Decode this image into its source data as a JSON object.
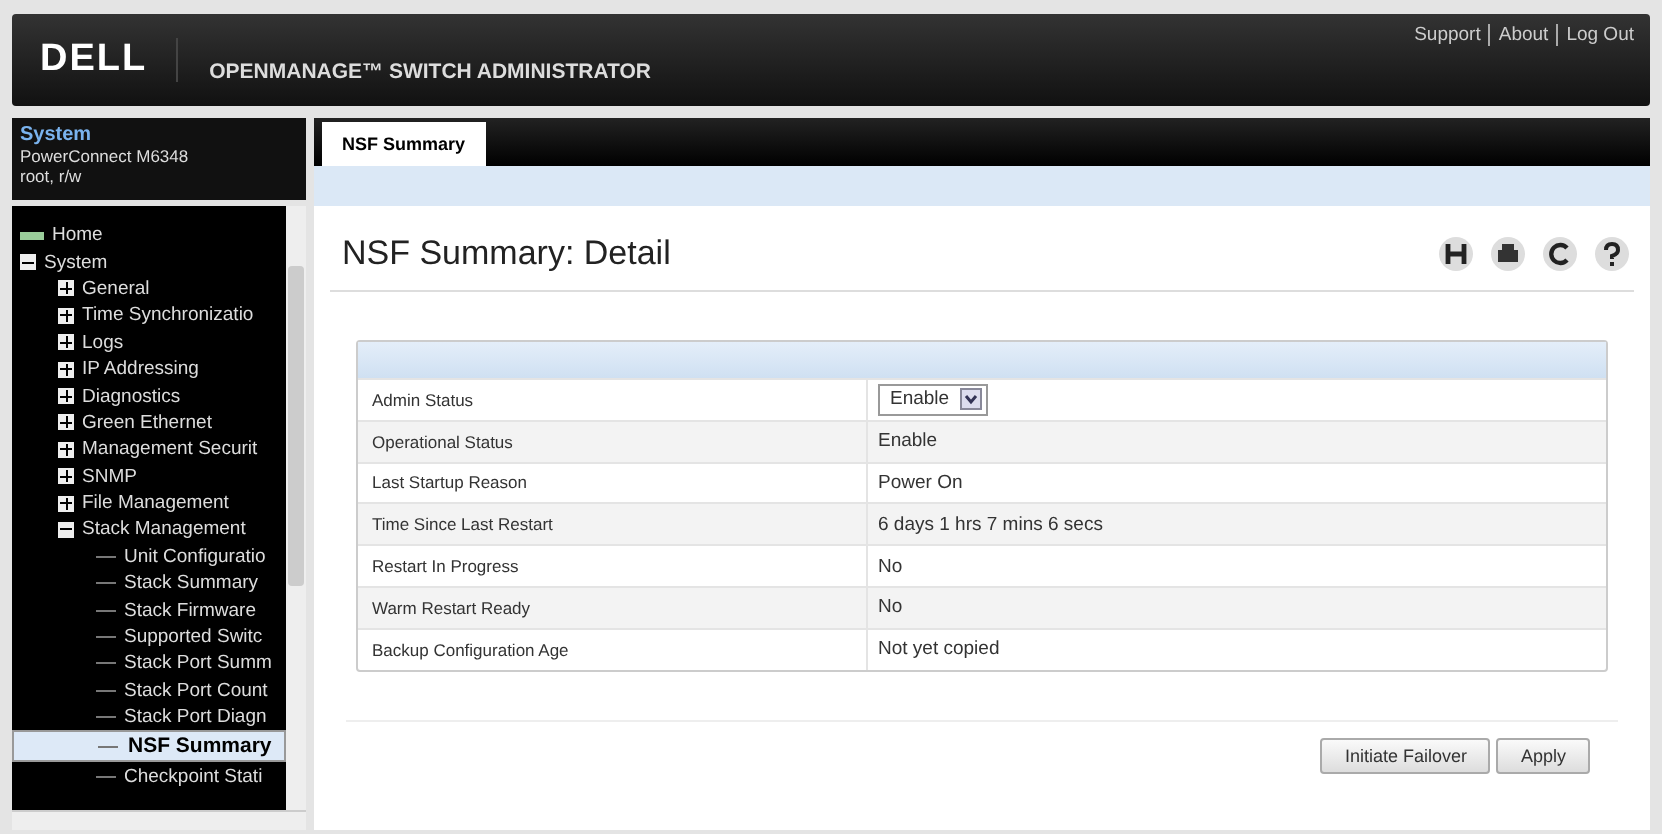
{
  "header": {
    "brand": "DELL",
    "product": "OPENMANAGE™ SWITCH ADMINISTRATOR",
    "links": [
      "Support",
      "About",
      "Log Out"
    ]
  },
  "system": {
    "title": "System",
    "model": "PowerConnect M6348",
    "user": "root, r/w"
  },
  "tree": [
    {
      "label": "Home",
      "kind": "home",
      "selected": false
    },
    {
      "label": "System",
      "kind": "folder",
      "expanded": true,
      "selected": false,
      "children": [
        {
          "label": "General",
          "kind": "folder",
          "expanded": false,
          "selected": false
        },
        {
          "label": "Time Synchronizatio",
          "kind": "folder",
          "expanded": false,
          "selected": false
        },
        {
          "label": "Logs",
          "kind": "folder",
          "expanded": false,
          "selected": false
        },
        {
          "label": "IP Addressing",
          "kind": "folder",
          "expanded": false,
          "selected": false
        },
        {
          "label": "Diagnostics",
          "kind": "folder",
          "expanded": false,
          "selected": false
        },
        {
          "label": "Green Ethernet",
          "kind": "folder",
          "expanded": false,
          "selected": false
        },
        {
          "label": "Management Securit",
          "kind": "folder",
          "expanded": false,
          "selected": false
        },
        {
          "label": "SNMP",
          "kind": "folder",
          "expanded": false,
          "selected": false
        },
        {
          "label": "File Management",
          "kind": "folder",
          "expanded": false,
          "selected": false
        },
        {
          "label": "Stack Management",
          "kind": "folder",
          "expanded": true,
          "selected": false,
          "children": [
            {
              "label": "Unit Configuratio",
              "kind": "page",
              "selected": false
            },
            {
              "label": "Stack Summary",
              "kind": "page",
              "selected": false
            },
            {
              "label": "Stack Firmware",
              "kind": "page",
              "selected": false
            },
            {
              "label": "Supported Switc",
              "kind": "page",
              "selected": false
            },
            {
              "label": "Stack Port Summ",
              "kind": "page",
              "selected": false
            },
            {
              "label": "Stack Port Count",
              "kind": "page",
              "selected": false
            },
            {
              "label": "Stack Port Diagn",
              "kind": "page",
              "selected": false
            },
            {
              "label": "NSF Summary",
              "kind": "page",
              "selected": true
            },
            {
              "label": "Checkpoint Stati",
              "kind": "page",
              "selected": false
            }
          ]
        }
      ]
    }
  ],
  "tabs": [
    {
      "label": "NSF Summary",
      "selected": true
    }
  ],
  "page_title": "NSF Summary: Detail",
  "table": {
    "rows": [
      {
        "label": "Admin Status",
        "kind": "select",
        "value": "Enable"
      },
      {
        "label": "Operational Status",
        "kind": "text",
        "value": "Enable"
      },
      {
        "label": "Last Startup Reason",
        "kind": "text",
        "value": "Power On"
      },
      {
        "label": "Time Since Last Restart",
        "kind": "text",
        "value": "6 days 1 hrs 7 mins 6 secs"
      },
      {
        "label": "Restart In Progress",
        "kind": "text",
        "value": "No"
      },
      {
        "label": "Warm Restart Ready",
        "kind": "text",
        "value": "No"
      },
      {
        "label": "Backup Configuration Age",
        "kind": "text",
        "value": "Not yet copied"
      }
    ]
  },
  "buttons": [
    "Initiate Failover",
    "Apply"
  ]
}
